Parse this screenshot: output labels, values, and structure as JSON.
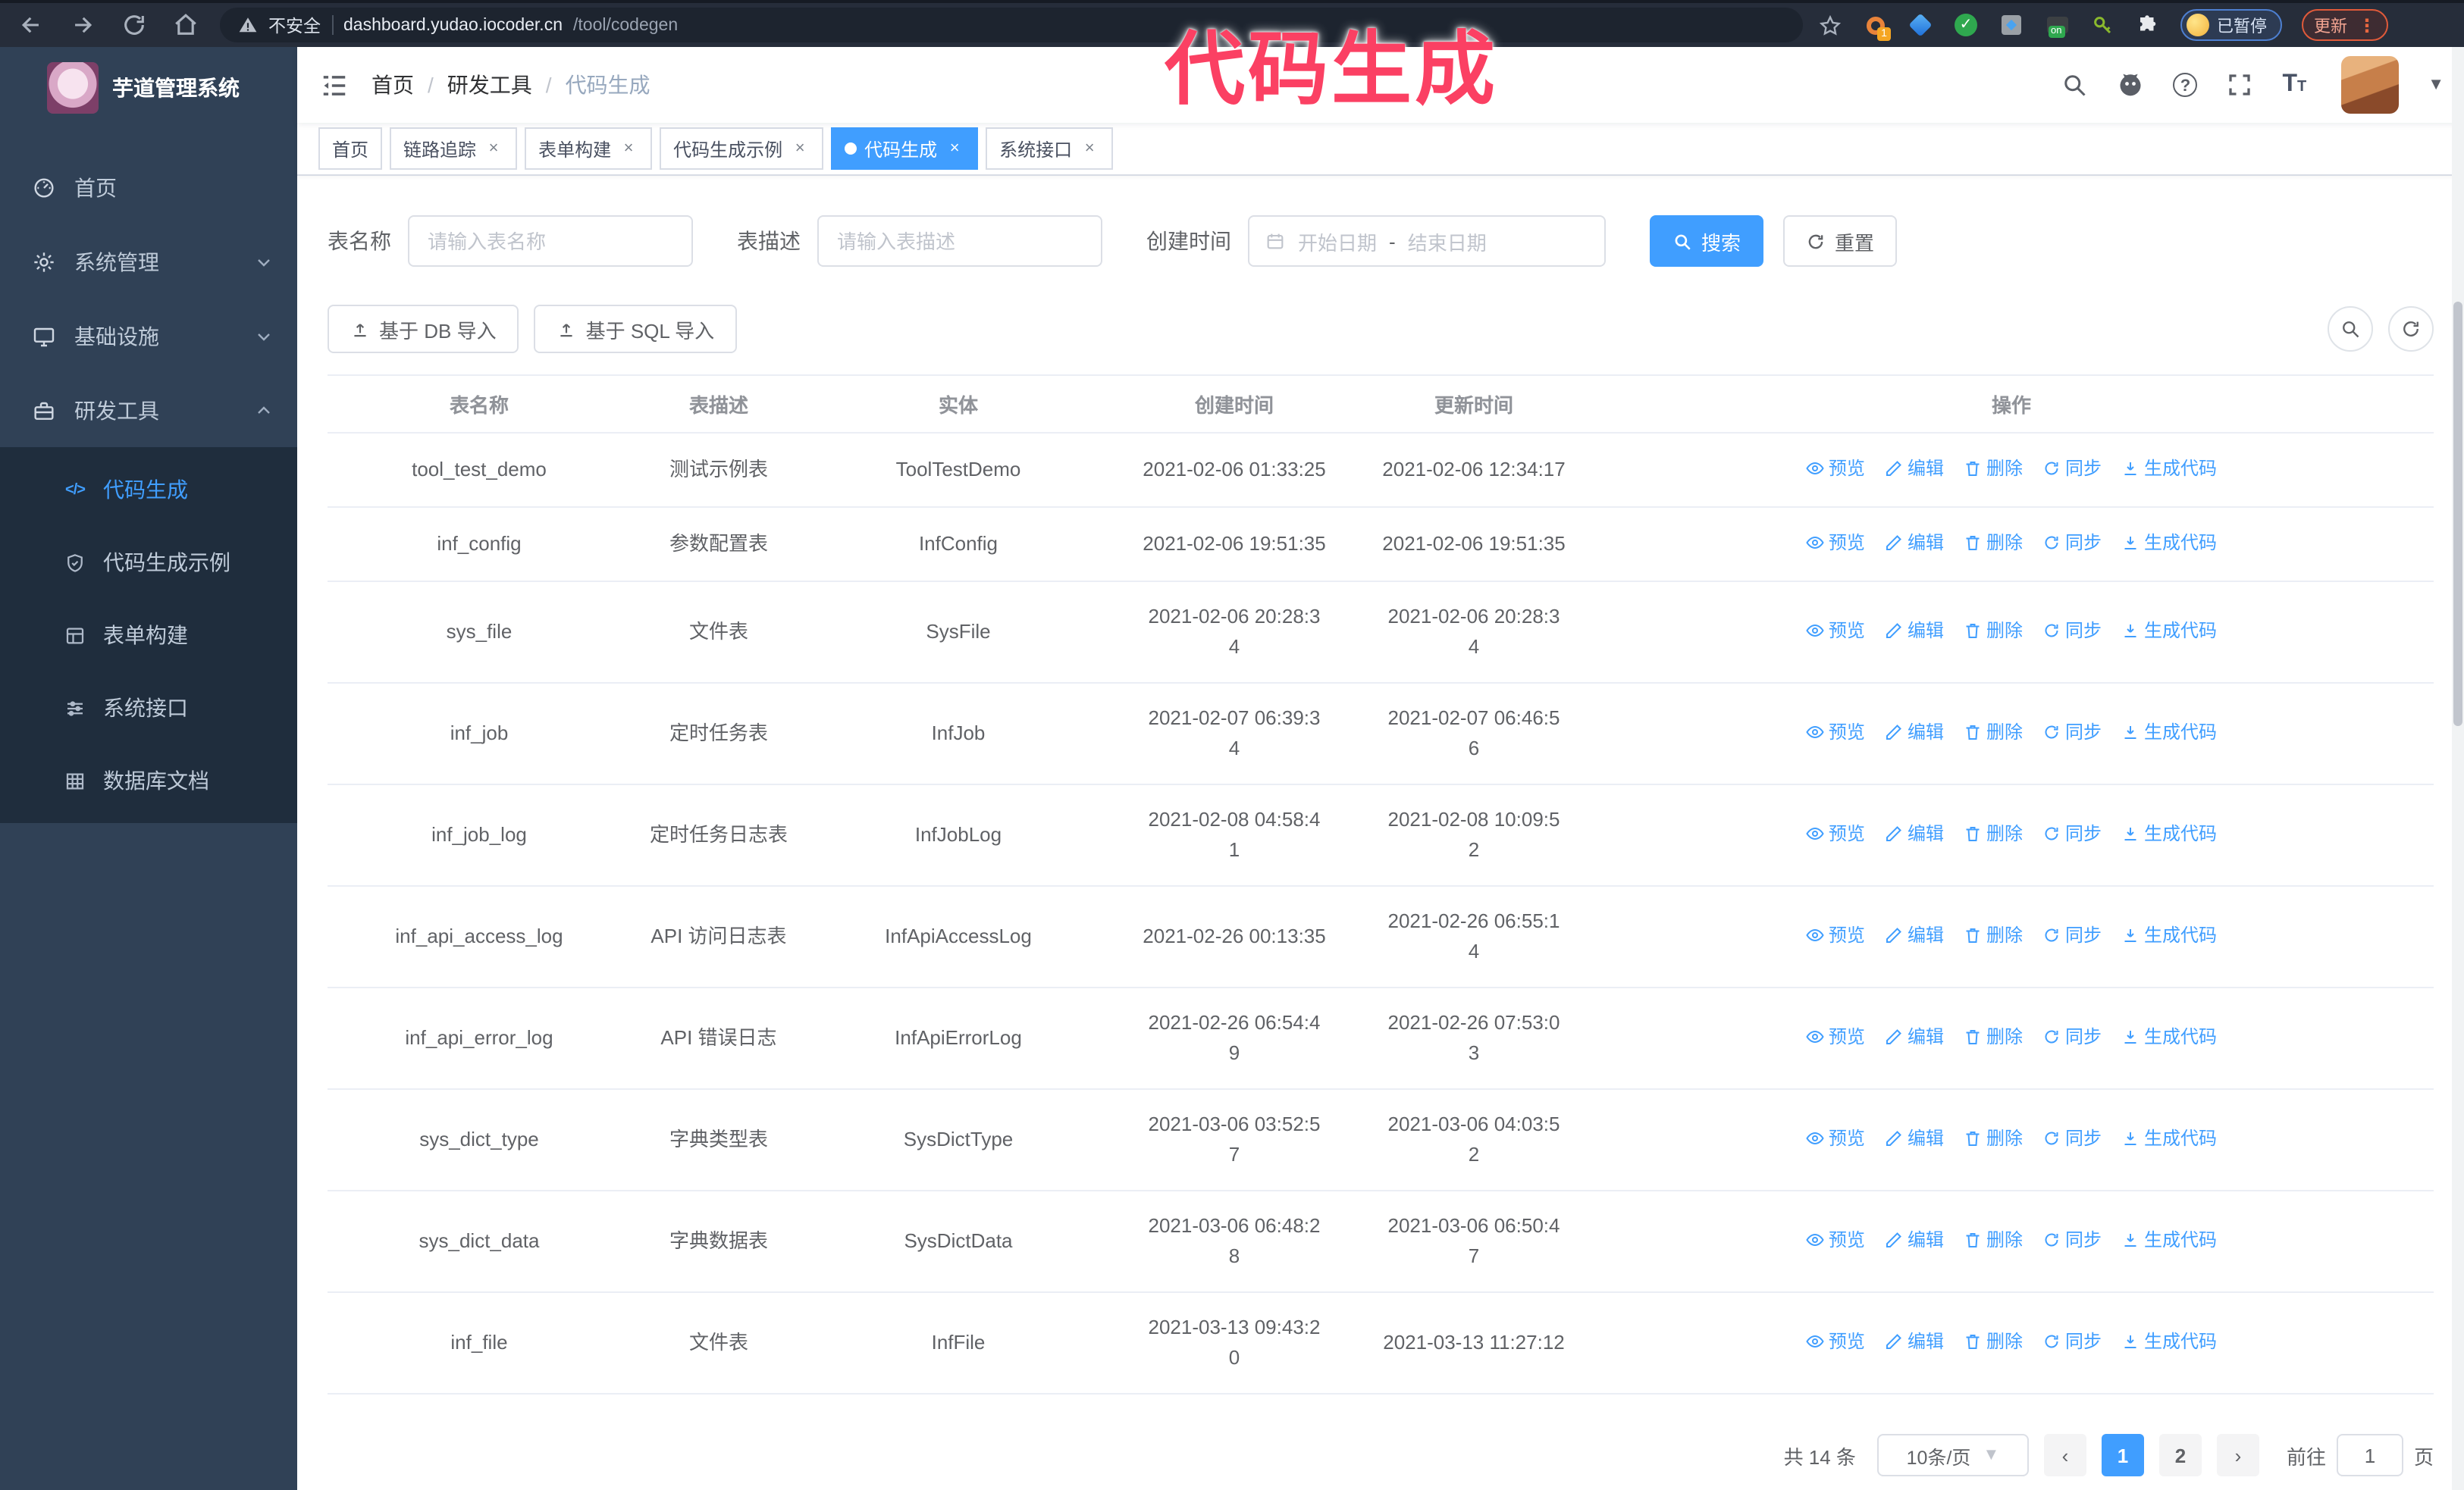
{
  "browser": {
    "security_label": "不安全",
    "url_host": "dashboard.yudao.iocoder.cn",
    "url_path": "/tool/codegen",
    "extension_badge_count": "1",
    "ext_on_label": "on",
    "paused_label": "已暂停",
    "update_label": "更新"
  },
  "annotation": {
    "text": "代码生成",
    "color": "#fb4063"
  },
  "sidebar": {
    "logo_title": "芋道管理系统",
    "menu": [
      {
        "label": "首页",
        "icon": "dashboard-icon"
      },
      {
        "label": "系统管理",
        "icon": "gear-icon"
      },
      {
        "label": "基础设施",
        "icon": "monitor-icon"
      },
      {
        "label": "研发工具",
        "icon": "toolbox-icon"
      }
    ],
    "submenu": [
      {
        "label": "代码生成",
        "icon": "code-icon",
        "active": true
      },
      {
        "label": "代码生成示例",
        "icon": "shield-check-icon"
      },
      {
        "label": "表单构建",
        "icon": "form-icon"
      },
      {
        "label": "系统接口",
        "icon": "sliders-icon"
      },
      {
        "label": "数据库文档",
        "icon": "database-doc-icon"
      }
    ]
  },
  "navbar": {
    "breadcrumb": [
      "首页",
      "研发工具",
      "代码生成"
    ],
    "breadcrumb_separator": "/"
  },
  "tags": [
    {
      "label": "首页",
      "closable": false
    },
    {
      "label": "链路追踪",
      "closable": true
    },
    {
      "label": "表单构建",
      "closable": true
    },
    {
      "label": "代码生成示例",
      "closable": true
    },
    {
      "label": "代码生成",
      "closable": true,
      "active": true
    },
    {
      "label": "系统接口",
      "closable": true
    }
  ],
  "filters": {
    "table_name_label": "表名称",
    "table_name_placeholder": "请输入表名称",
    "table_desc_label": "表描述",
    "table_desc_placeholder": "请输入表描述",
    "create_time_label": "创建时间",
    "date_start_placeholder": "开始日期",
    "date_separator": "-",
    "date_end_placeholder": "结束日期",
    "search_label": "搜索",
    "reset_label": "重置"
  },
  "toolbar": {
    "db_import_label": "基于 DB 导入",
    "sql_import_label": "基于 SQL 导入"
  },
  "table": {
    "columns": [
      "表名称",
      "表描述",
      "实体",
      "创建时间",
      "更新时间",
      "操作"
    ],
    "actions": [
      "预览",
      "编辑",
      "删除",
      "同步",
      "生成代码"
    ],
    "rows": [
      {
        "name": "tool_test_demo",
        "desc": "测试示例表",
        "entity": "ToolTestDemo",
        "created": "2021-02-06 01:33:25",
        "updated": "2021-02-06 12:34:17"
      },
      {
        "name": "inf_config",
        "desc": "参数配置表",
        "entity": "InfConfig",
        "created": "2021-02-06 19:51:35",
        "updated": "2021-02-06 19:51:35"
      },
      {
        "name": "sys_file",
        "desc": "文件表",
        "entity": "SysFile",
        "created": "2021-02-06 20:28:3\n4",
        "updated": "2021-02-06 20:28:3\n4"
      },
      {
        "name": "inf_job",
        "desc": "定时任务表",
        "entity": "InfJob",
        "created": "2021-02-07 06:39:3\n4",
        "updated": "2021-02-07 06:46:5\n6"
      },
      {
        "name": "inf_job_log",
        "desc": "定时任务日志表",
        "entity": "InfJobLog",
        "created": "2021-02-08 04:58:4\n1",
        "updated": "2021-02-08 10:09:5\n2"
      },
      {
        "name": "inf_api_access_log",
        "desc": "API 访问日志表",
        "entity": "InfApiAccessLog",
        "created": "2021-02-26 00:13:35",
        "updated": "2021-02-26 06:55:1\n4"
      },
      {
        "name": "inf_api_error_log",
        "desc": "API 错误日志",
        "entity": "InfApiErrorLog",
        "created": "2021-02-26 06:54:4\n9",
        "updated": "2021-02-26 07:53:0\n3"
      },
      {
        "name": "sys_dict_type",
        "desc": "字典类型表",
        "entity": "SysDictType",
        "created": "2021-03-06 03:52:5\n7",
        "updated": "2021-03-06 04:03:5\n2"
      },
      {
        "name": "sys_dict_data",
        "desc": "字典数据表",
        "entity": "SysDictData",
        "created": "2021-03-06 06:48:2\n8",
        "updated": "2021-03-06 06:50:4\n7"
      },
      {
        "name": "inf_file",
        "desc": "文件表",
        "entity": "InfFile",
        "created": "2021-03-13 09:43:2\n0",
        "updated": "2021-03-13 11:27:12"
      }
    ]
  },
  "pagination": {
    "total_label": "共 14 条",
    "page_size_label": "10条/页",
    "pages": [
      "1",
      "2"
    ],
    "active_page": "1",
    "goto_label": "前往",
    "goto_value": "1",
    "page_unit_label": "页"
  },
  "colors": {
    "accent": "#409eff",
    "sidebar_bg": "#304156",
    "submenu_bg": "#1f2d3d"
  }
}
